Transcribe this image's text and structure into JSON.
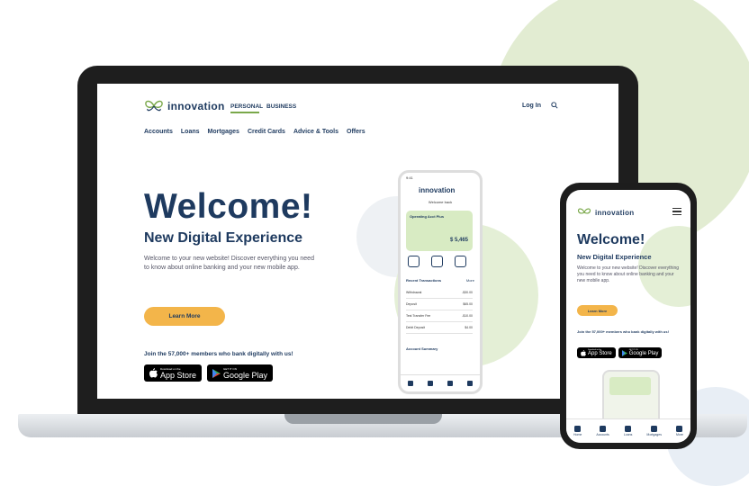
{
  "brand": {
    "name": "innovation",
    "colors": {
      "navy": "#1e3a5f",
      "accent_green": "#7aa84a",
      "button_orange": "#f3b54a"
    }
  },
  "desktop": {
    "header": {
      "segments": [
        "PERSONAL",
        "BUSINESS"
      ],
      "active_segment": "PERSONAL",
      "login": "Log In"
    },
    "nav": [
      "Accounts",
      "Loans",
      "Mortgages",
      "Credit Cards",
      "Advice & Tools",
      "Offers"
    ],
    "hero": {
      "title": "Welcome!",
      "subtitle": "New Digital Experience",
      "body": "Welcome to your new website! Discover everything you need to know about online banking and your new mobile app.",
      "cta": "Learn More",
      "join": "Join the 57,000+ members who bank digitally with us!"
    },
    "stores": {
      "apple_small": "Download on the",
      "apple": "App Store",
      "google_small": "GET IT ON",
      "google": "Google Play"
    },
    "mockup": {
      "status_time": "9:41",
      "welcome": "Welcome back",
      "card_title": "Operating Acct Plus",
      "balance": "$ 5,465",
      "recent": "Recent Transactions",
      "more": "More",
      "transactions": [
        {
          "desc": "Withdrawal",
          "amount": "-$30.00"
        },
        {
          "desc": "Deposit",
          "amount": "$65.00"
        },
        {
          "desc": "Test Transfer Fee",
          "amount": "-$10.00"
        },
        {
          "desc": "Debit Deposit",
          "amount": "$4.00"
        }
      ],
      "account_summary": "Account Summary"
    }
  },
  "mobile": {
    "title": "Welcome!",
    "subtitle": "New Digital Experience",
    "body": "Welcome to your new website! Discover everything you need to know about online banking and your new mobile app.",
    "cta": "Learn More",
    "join": "Join the 57,000+ members who bank digitally with us!",
    "tabs": [
      "Home",
      "Accounts",
      "Loans",
      "Mortgages",
      "More"
    ]
  }
}
